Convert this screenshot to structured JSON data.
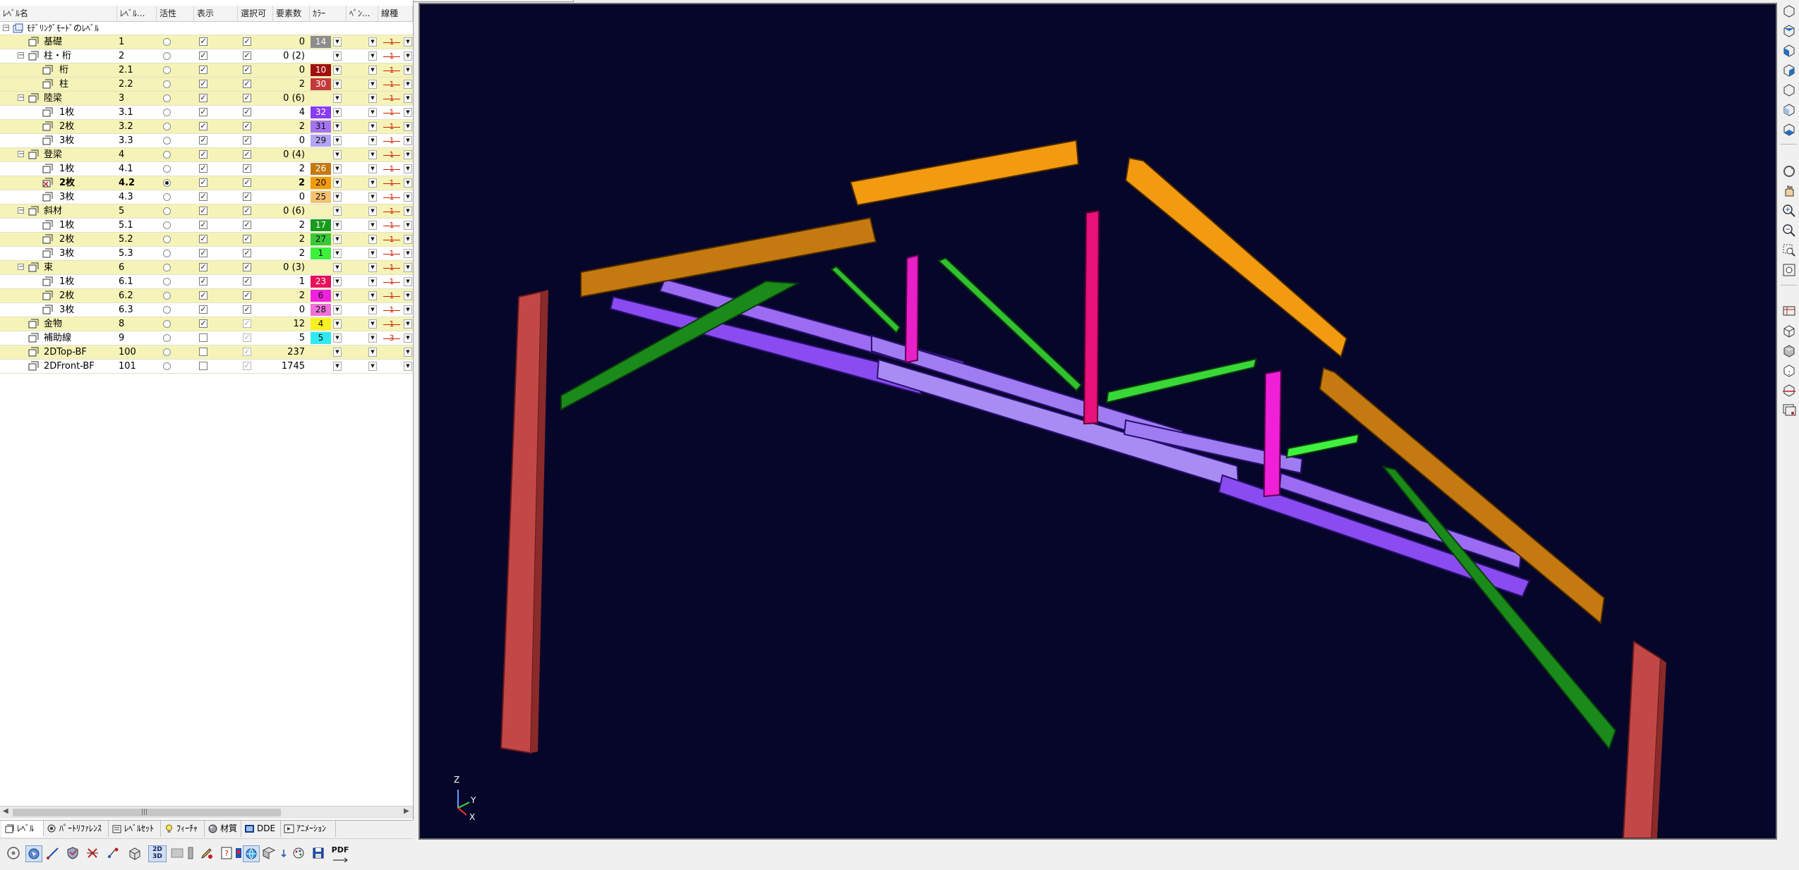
{
  "level_panel": {
    "columns": {
      "name": "ﾚﾍﾞﾙ名",
      "level": "ﾚﾍﾞﾙ...",
      "active": "活性",
      "display": "表示",
      "selectable": "選択可",
      "count": "要素数",
      "color": "ｶﾗｰ",
      "pen": "ﾍﾟﾝ...",
      "linetype": "線種"
    },
    "root_label": "ﾓﾃﾞﾘﾝｸﾞﾓｰﾄﾞのﾚﾍﾞﾙ",
    "rows": [
      {
        "name": "基礎",
        "level": "1",
        "count": "0",
        "color_label": "14",
        "color": "#8c8c8c",
        "indent": 1,
        "expander": "",
        "row_color": "yel",
        "display": true,
        "selectable": true,
        "dim": false,
        "active": false,
        "linetype": "1"
      },
      {
        "name": "柱・桁",
        "level": "2",
        "count": "0 (2)",
        "color_label": "",
        "color": "#ffffff",
        "indent": 1,
        "expander": "⊟",
        "row_color": "wht",
        "display": true,
        "selectable": true,
        "dim": false,
        "active": false,
        "linetype": "1"
      },
      {
        "name": "桁",
        "level": "2.1",
        "count": "0",
        "color_label": "10",
        "color": "#a01010",
        "indent": 2,
        "expander": "",
        "row_color": "yel",
        "display": true,
        "selectable": true,
        "dim": false,
        "active": false,
        "linetype": "1"
      },
      {
        "name": "柱",
        "level": "2.2",
        "count": "2",
        "color_label": "30",
        "color": "#c43a3a",
        "indent": 2,
        "expander": "",
        "row_color": "yel",
        "display": true,
        "selectable": true,
        "dim": false,
        "active": false,
        "linetype": "1"
      },
      {
        "name": "陸梁",
        "level": "3",
        "count": "0 (6)",
        "color_label": "",
        "color": "#f5f3b8",
        "indent": 1,
        "expander": "⊟",
        "row_color": "yel",
        "display": true,
        "selectable": true,
        "dim": false,
        "active": false,
        "linetype": "1"
      },
      {
        "name": "1枚",
        "level": "3.1",
        "count": "4",
        "color_label": "32",
        "color": "#8a3cf0",
        "indent": 2,
        "expander": "",
        "row_color": "wht",
        "display": true,
        "selectable": true,
        "dim": false,
        "active": false,
        "linetype": "1"
      },
      {
        "name": "2枚",
        "level": "3.2",
        "count": "2",
        "color_label": "31",
        "color": "#a574f2",
        "indent": 2,
        "expander": "",
        "row_color": "yel",
        "display": true,
        "selectable": true,
        "dim": false,
        "active": false,
        "linetype": "1"
      },
      {
        "name": "3枚",
        "level": "3.3",
        "count": "0",
        "color_label": "29",
        "color": "#b4a4f4",
        "indent": 2,
        "expander": "",
        "row_color": "wht",
        "display": true,
        "selectable": true,
        "dim": false,
        "active": false,
        "linetype": "1"
      },
      {
        "name": "登梁",
        "level": "4",
        "count": "0 (4)",
        "color_label": "",
        "color": "#f5f3b8",
        "indent": 1,
        "expander": "⊟",
        "row_color": "yel",
        "display": true,
        "selectable": true,
        "dim": false,
        "active": false,
        "linetype": "1"
      },
      {
        "name": "1枚",
        "level": "4.1",
        "count": "2",
        "color_label": "26",
        "color": "#c47a10",
        "indent": 2,
        "expander": "",
        "row_color": "wht",
        "display": true,
        "selectable": true,
        "dim": false,
        "active": false,
        "linetype": "1"
      },
      {
        "name": "2枚",
        "level": "4.2",
        "count": "2",
        "color_label": "20",
        "color": "#f29a10",
        "indent": 2,
        "expander": "",
        "row_color": "yel",
        "display": true,
        "selectable": true,
        "dim": false,
        "active": true,
        "bold": true,
        "linetype": "1"
      },
      {
        "name": "3枚",
        "level": "4.3",
        "count": "0",
        "color_label": "25",
        "color": "#f5c070",
        "indent": 2,
        "expander": "",
        "row_color": "wht",
        "display": true,
        "selectable": true,
        "dim": false,
        "active": false,
        "linetype": "1"
      },
      {
        "name": "斜材",
        "level": "5",
        "count": "0 (6)",
        "color_label": "",
        "color": "#f5f3b8",
        "indent": 1,
        "expander": "⊟",
        "row_color": "yel",
        "display": true,
        "selectable": true,
        "dim": false,
        "active": false,
        "linetype": "1"
      },
      {
        "name": "1枚",
        "level": "5.1",
        "count": "2",
        "color_label": "17",
        "color": "#1a9a1a",
        "indent": 2,
        "expander": "",
        "row_color": "wht",
        "display": true,
        "selectable": true,
        "dim": false,
        "active": false,
        "linetype": "1"
      },
      {
        "name": "2枚",
        "level": "5.2",
        "count": "2",
        "color_label": "27",
        "color": "#38c838",
        "indent": 2,
        "expander": "",
        "row_color": "yel",
        "display": true,
        "selectable": true,
        "dim": false,
        "active": false,
        "linetype": "1"
      },
      {
        "name": "3枚",
        "level": "5.3",
        "count": "2",
        "color_label": "1",
        "color": "#3cf03c",
        "indent": 2,
        "expander": "",
        "row_color": "wht",
        "display": true,
        "selectable": true,
        "dim": false,
        "active": false,
        "linetype": "1"
      },
      {
        "name": "束",
        "level": "6",
        "count": "0 (3)",
        "color_label": "",
        "color": "#f5f3b8",
        "indent": 1,
        "expander": "⊟",
        "row_color": "yel",
        "display": true,
        "selectable": true,
        "dim": false,
        "active": false,
        "linetype": "1"
      },
      {
        "name": "1枚",
        "level": "6.1",
        "count": "1",
        "color_label": "23",
        "color": "#e8105a",
        "indent": 2,
        "expander": "",
        "row_color": "wht",
        "display": true,
        "selectable": true,
        "dim": false,
        "active": false,
        "linetype": "1"
      },
      {
        "name": "2枚",
        "level": "6.2",
        "count": "2",
        "color_label": "6",
        "color": "#f020e0",
        "indent": 2,
        "expander": "",
        "row_color": "yel",
        "display": true,
        "selectable": true,
        "dim": false,
        "active": false,
        "linetype": "1"
      },
      {
        "name": "3枚",
        "level": "6.3",
        "count": "0",
        "color_label": "28",
        "color": "#f070d8",
        "indent": 2,
        "expander": "",
        "row_color": "wht",
        "display": true,
        "selectable": true,
        "dim": false,
        "active": false,
        "linetype": "1"
      },
      {
        "name": "金物",
        "level": "8",
        "count": "12",
        "color_label": "4",
        "color": "#f8f020",
        "indent": 1,
        "expander": "",
        "row_color": "yel",
        "display": true,
        "selectable": true,
        "dim": true,
        "active": false,
        "linetype": "1"
      },
      {
        "name": "補助線",
        "level": "9",
        "count": "5",
        "color_label": "5",
        "color": "#30e8f0",
        "indent": 1,
        "expander": "",
        "row_color": "wht",
        "display": false,
        "selectable": true,
        "dim": true,
        "active": false,
        "linetype": "3"
      },
      {
        "name": "2DTop-BF",
        "level": "100",
        "count": "237",
        "color_label": "",
        "color": "#f5f3b8",
        "indent": 1,
        "expander": "",
        "row_color": "yel",
        "display": false,
        "selectable": true,
        "dim": true,
        "active": false,
        "linetype": ""
      },
      {
        "name": "2DFront-BF",
        "level": "101",
        "count": "1745",
        "color_label": "",
        "color": "#ffffff",
        "indent": 1,
        "expander": "",
        "row_color": "wht",
        "display": false,
        "selectable": true,
        "dim": true,
        "active": false,
        "linetype": ""
      }
    ]
  },
  "tabs": [
    {
      "label": "ﾚﾍﾞﾙ",
      "active": true
    },
    {
      "label": "ﾊﾟｰﾄﾘﾌｧﾚﾝｽ",
      "active": false
    },
    {
      "label": "ﾚﾍﾞﾙｾｯﾄ",
      "active": false
    },
    {
      "label": "ﾌｨｰﾁｬ",
      "active": false
    },
    {
      "label": "材質",
      "active": false
    },
    {
      "label": "DDE",
      "active": false
    },
    {
      "label": "ｱﾆﾒｰｼｮﾝ",
      "active": false
    }
  ],
  "bottom_toolbar": {
    "buttons": [
      "orbit-icon",
      "select-icon",
      "line-icon",
      "shield-icon",
      "trim-icon",
      "pan-icon",
      "box-icon",
      "2d3d-icon",
      "blank-icon",
      "ruler-icon",
      "edit-icon",
      "help-icon",
      "render-icon",
      "globe-icon",
      "view-icon",
      "arrow-icon",
      "palette-icon",
      "save-icon",
      "pdf-icon"
    ],
    "label_2d3d_top": "2D",
    "label_2d3d_bottom": "3D",
    "label_pdf": "PDF"
  },
  "viewport": {
    "background": "#06062a",
    "axis": {
      "z": "Z",
      "y": "Y",
      "x": "X"
    }
  }
}
